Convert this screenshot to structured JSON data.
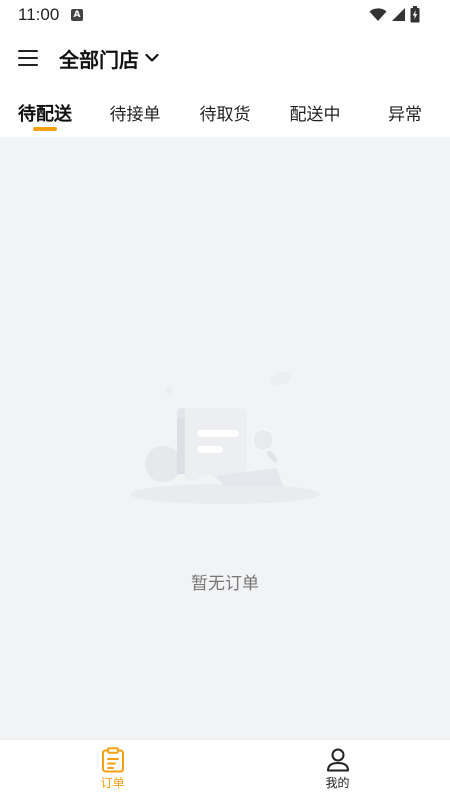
{
  "status_bar": {
    "time": "11:00",
    "badge": "A"
  },
  "header": {
    "store_title": "全部门店"
  },
  "tabs": [
    {
      "label": "待配送",
      "active": true
    },
    {
      "label": "待接单",
      "active": false
    },
    {
      "label": "待取货",
      "active": false
    },
    {
      "label": "配送中",
      "active": false
    },
    {
      "label": "异常",
      "active": false
    }
  ],
  "main": {
    "empty_text": "暂无订单"
  },
  "bottom_nav": [
    {
      "label": "订单",
      "icon": "clipboard-icon",
      "active": true
    },
    {
      "label": "我的",
      "icon": "person-icon",
      "active": false
    }
  ],
  "colors": {
    "accent": "#f5a010",
    "content_bg": "#f2f3f5"
  }
}
